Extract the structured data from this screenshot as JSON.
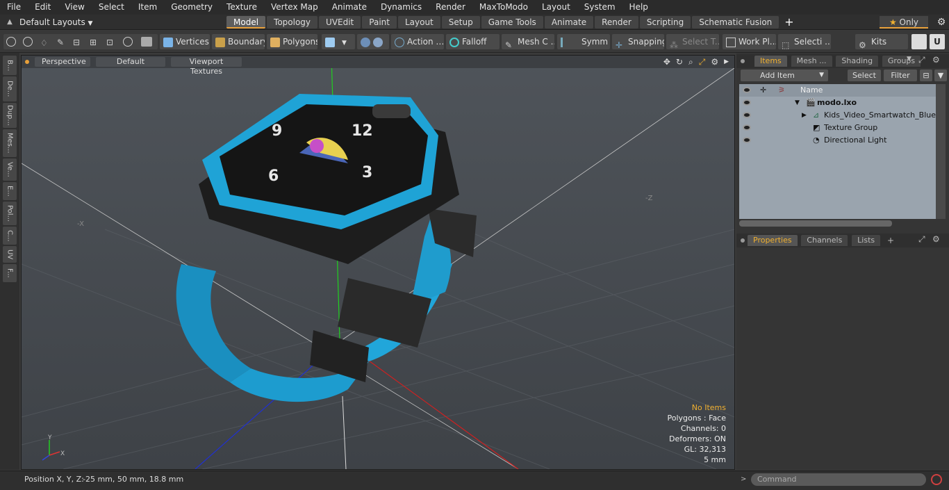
{
  "menubar": {
    "items": [
      "File",
      "Edit",
      "View",
      "Select",
      "Item",
      "Geometry",
      "Texture",
      "Vertex Map",
      "Animate",
      "Dynamics",
      "Render",
      "MaxToModo",
      "Layout",
      "System",
      "Help"
    ]
  },
  "layoutbar": {
    "layout_select": "Default Layouts",
    "tabs": [
      "Model",
      "Topology",
      "UVEdit",
      "Paint",
      "Layout",
      "Setup",
      "Game Tools",
      "Animate",
      "Render",
      "Scripting",
      "Schematic Fusion"
    ],
    "active_tab": "Model",
    "add_tab": "+",
    "only_label": "Only"
  },
  "toolbar": {
    "vertices": "Vertices",
    "boundary": "Boundary",
    "polygons": "Polygons",
    "action": "Action",
    "falloff": "Falloff",
    "mesh": "Mesh C ...",
    "symm": "Symm ...",
    "snapping": "Snapping",
    "select_t": "Select T...",
    "work_pl": "Work Pl...",
    "selecti": "Selecti ...",
    "kits": "Kits"
  },
  "lefttabs": [
    "B...",
    "De...",
    "Dup...",
    "Mes...",
    "Ve...",
    "E...",
    "Pol...",
    "C...",
    "UV",
    "F..."
  ],
  "viewport": {
    "view_mode": "Perspective",
    "shading": "Default",
    "textures": "Viewport Textures",
    "axis_labels": {
      "x": "X",
      "y": "Y",
      "z": "Z",
      "neg_x": "-X",
      "neg_z": "-Z"
    },
    "hud": {
      "no_items": "No Items",
      "polygons": "Polygons : Face",
      "channels": "Channels: 0",
      "deformers": "Deformers: ON",
      "gl": "GL: 32,313",
      "scale": "5 mm"
    }
  },
  "status": {
    "position_label": "Position X, Y, Z:",
    "position_value": "-25 mm, 50 mm, 18.8 mm"
  },
  "right": {
    "tabs": [
      "Items",
      "Mesh ...",
      "Shading",
      "Groups"
    ],
    "active_tab": "Items",
    "add_item": "Add Item",
    "select": "Select",
    "filter": "Filter",
    "col_name": "Name",
    "items": [
      {
        "label": "modo.lxo"
      },
      {
        "label": "Kids_Video_Smartwatch_Blue"
      },
      {
        "label": "Texture Group"
      },
      {
        "label": "Directional Light"
      }
    ],
    "bottom_tabs": [
      "Properties",
      "Channels",
      "Lists"
    ],
    "bottom_active": "Properties",
    "bottom_add": "+"
  },
  "command": {
    "placeholder": "Command"
  },
  "colors": {
    "accent": "#f0b030",
    "watch_blue": "#1fa3d6",
    "viewport": "#4b5056"
  }
}
